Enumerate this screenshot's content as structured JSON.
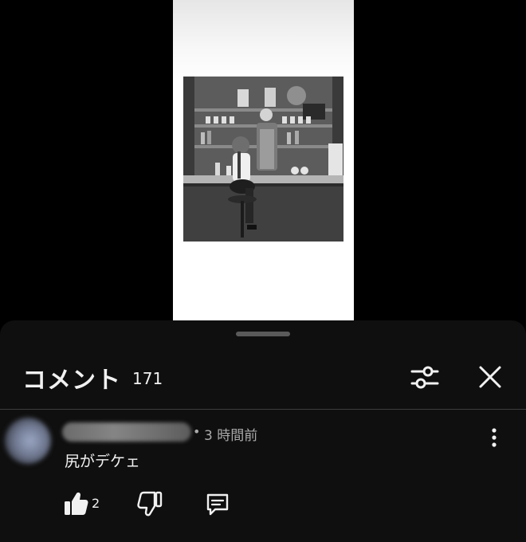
{
  "sheet": {
    "title": "コメント",
    "count": "171"
  },
  "icons": {
    "filter": "sliders-icon",
    "close": "close-icon",
    "more": "more-vertical-icon",
    "like": "thumbs-up-icon",
    "dislike": "thumbs-down-icon",
    "reply": "reply-comment-icon"
  },
  "comment": {
    "separator": "•",
    "timestamp": "3 時間前",
    "text": "尻がデケェ",
    "like_count": "2"
  },
  "colors": {
    "sheet_background": "#0f0f0f",
    "primary_text": "#f1f1f1",
    "secondary_text": "#aaaaaa",
    "divider": "#3d3d3d"
  }
}
